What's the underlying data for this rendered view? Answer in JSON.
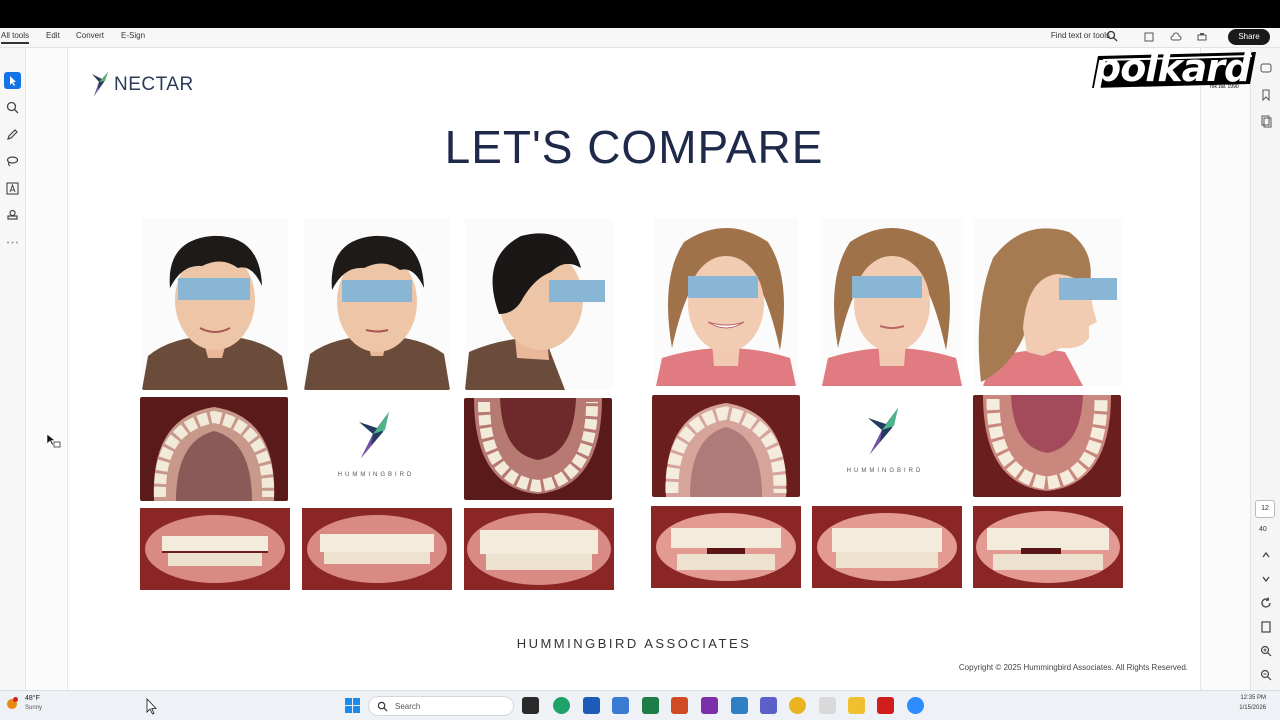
{
  "toolbar": {
    "menu": [
      "All tools",
      "Edit",
      "Convert",
      "E-Sign"
    ],
    "find_placeholder": "Find text or tools",
    "share_label": "Share"
  },
  "left_tools": [
    "select-icon",
    "zoom-icon",
    "pen-icon",
    "lasso-icon",
    "text-box-icon",
    "stamp-icon",
    "more-icon"
  ],
  "right_tools": {
    "page_number": "12",
    "page_total": "40"
  },
  "slide": {
    "brand": "NECTAR",
    "title": "LET'S COMPARE",
    "logo_caption_left": "HUMMINGBIRD",
    "logo_caption_right": "HUMMINGBIRD",
    "footer": "HUMMINGBIRD ASSOCIATES",
    "copyright": "Copyright © 2025 Hummingbird Associates. All Rights Reserved."
  },
  "watermark": {
    "brand": "polkard",
    "sub": "rok zał. 1990"
  },
  "taskbar": {
    "weather_temp": "48°F",
    "weather_desc": "Sunny",
    "search_placeholder": "Search",
    "time": "12:35 PM",
    "date": "1/15/2026"
  },
  "colors": {
    "accent": "#1473e6",
    "title": "#1f2a4a",
    "eye_bar": "#8ab6d6"
  }
}
